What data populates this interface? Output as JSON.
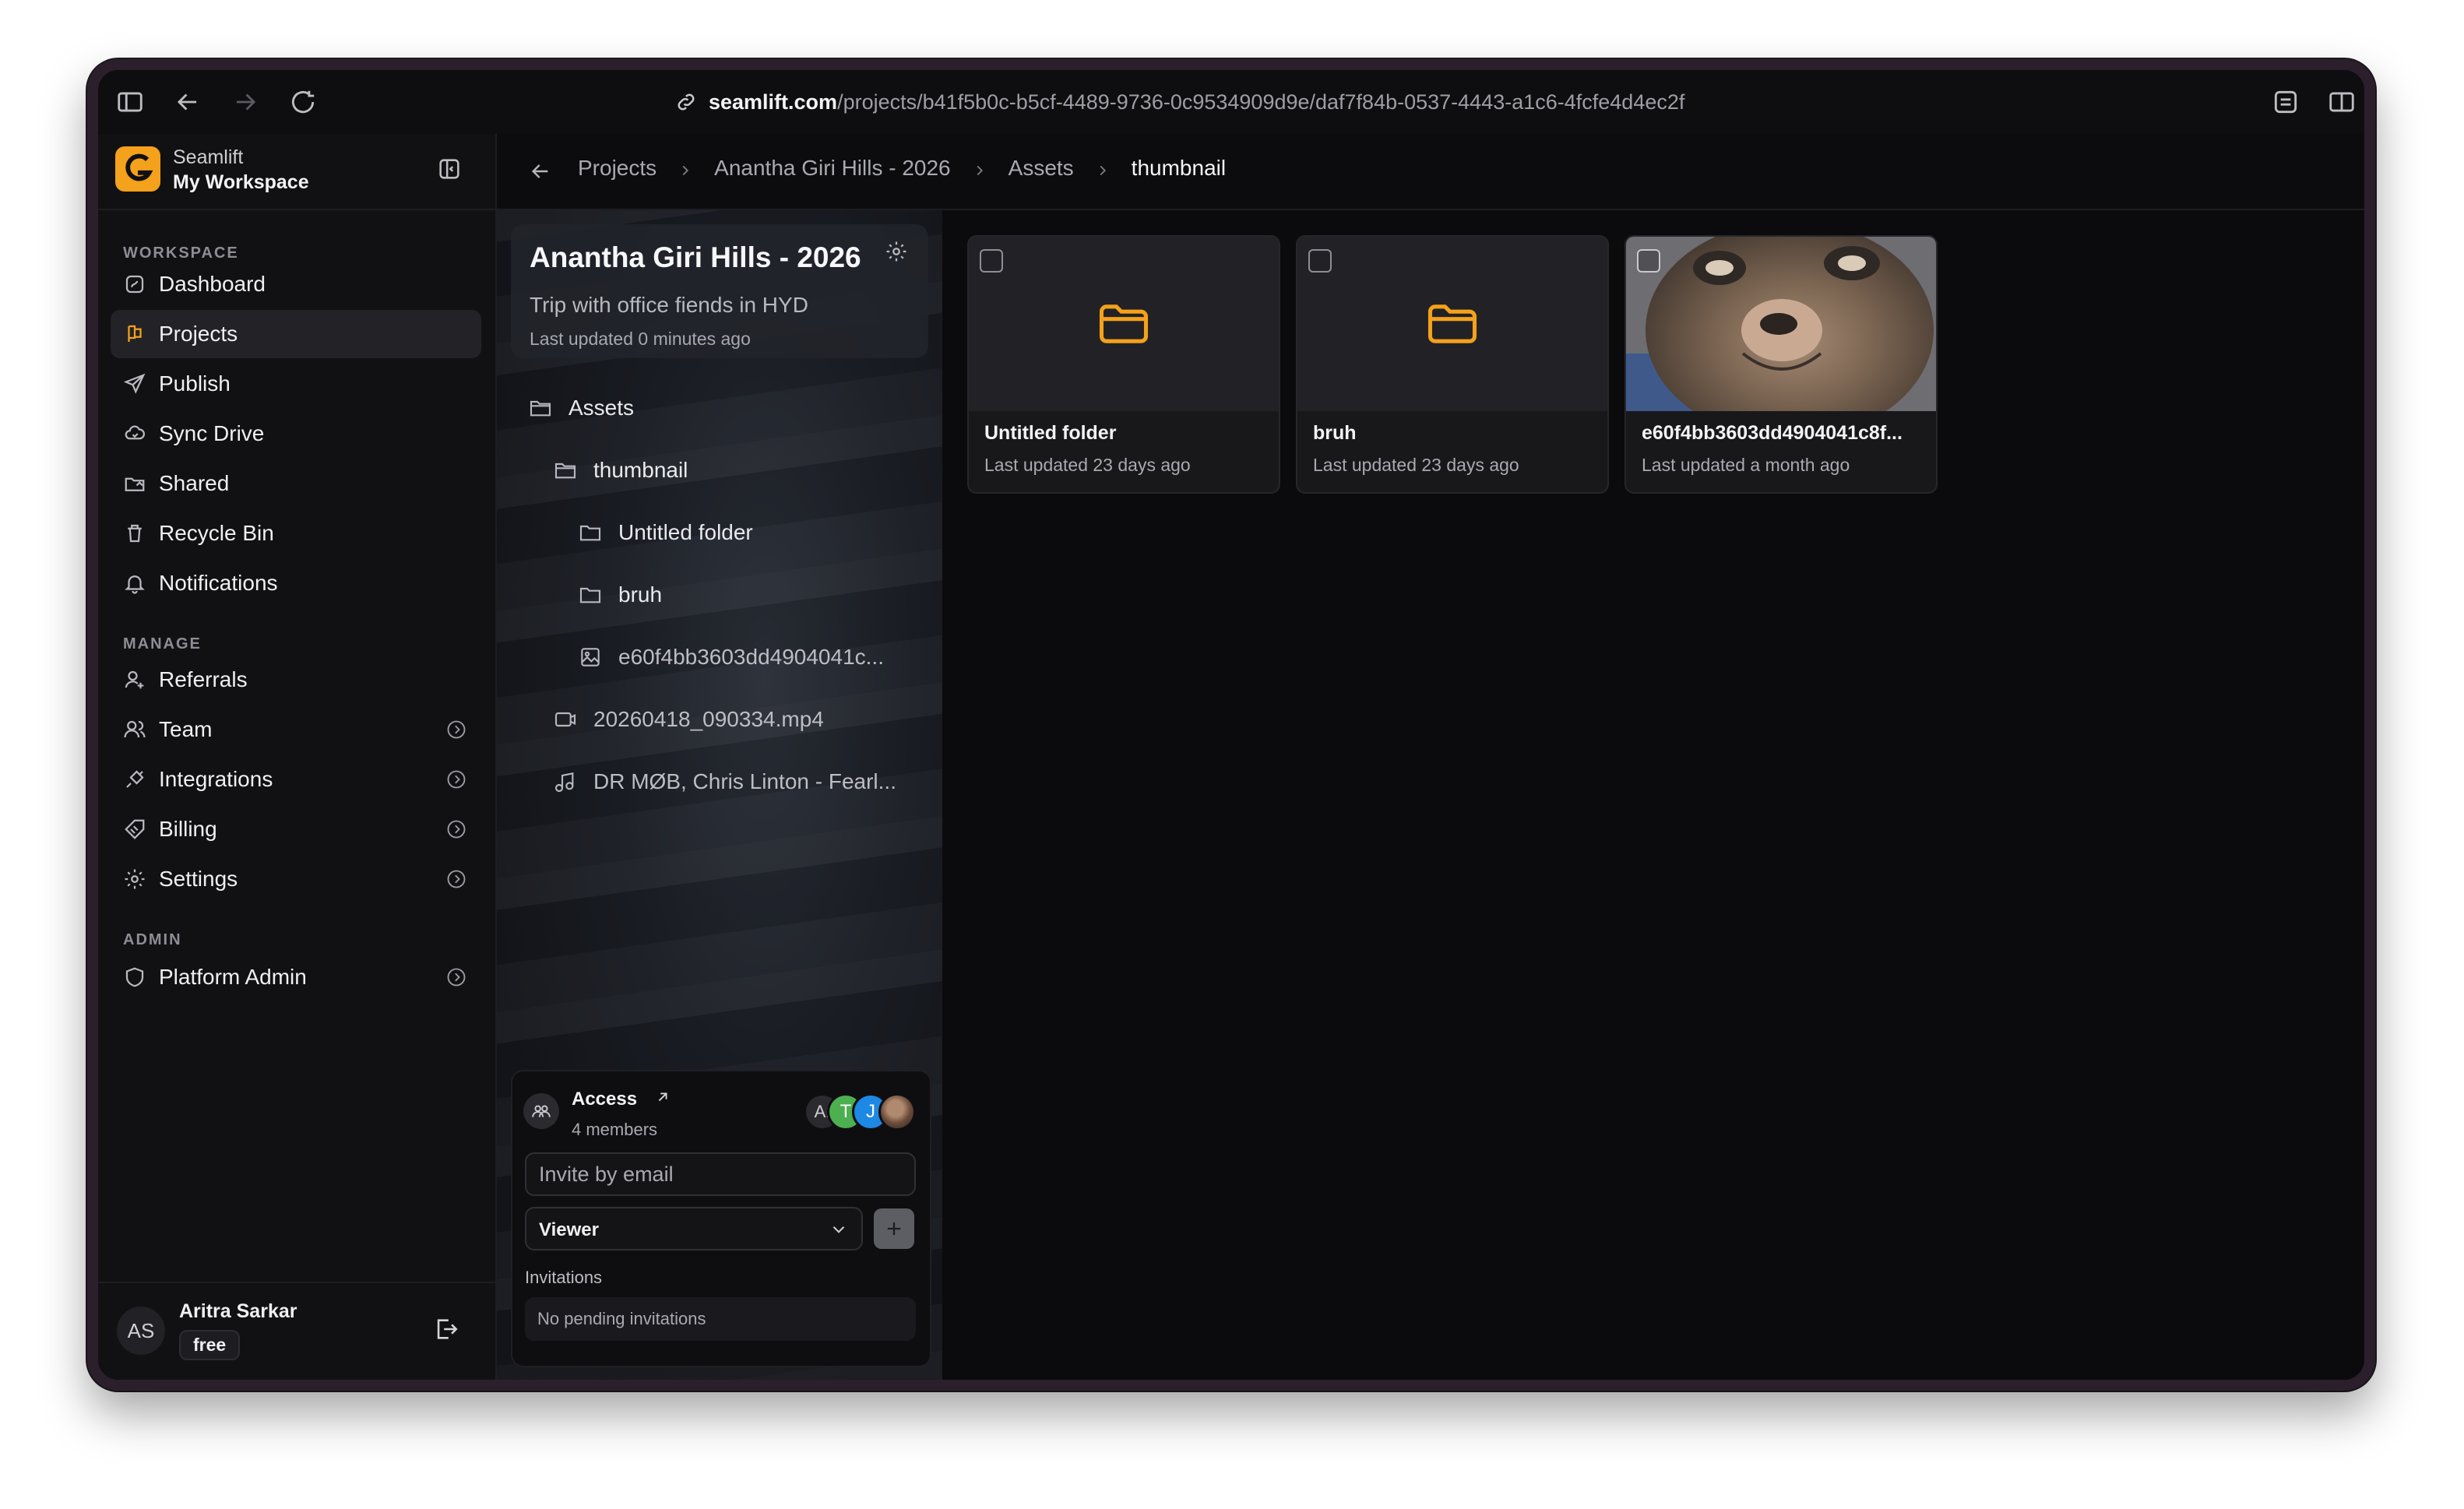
{
  "browser": {
    "url_host": "seamlift.com",
    "url_path": "/projects/b41f5b0c-b5cf-4489-9736-0c9534909d9e/daf7f84b-0537-4443-a1c6-4fcfe4d4ec2f"
  },
  "workspace": {
    "app_name": "Seamlift",
    "name": "My Workspace",
    "accent": "#f4a11b"
  },
  "sidebar": {
    "sections": {
      "workspace": "WORKSPACE",
      "manage": "MANAGE",
      "admin": "ADMIN"
    },
    "workspace_items": [
      {
        "label": "Dashboard",
        "icon": "dashboard-icon"
      },
      {
        "label": "Projects",
        "icon": "projects-icon",
        "active": true
      },
      {
        "label": "Publish",
        "icon": "send-icon"
      },
      {
        "label": "Sync Drive",
        "icon": "cloud-sync-icon"
      },
      {
        "label": "Shared",
        "icon": "shared-folder-icon"
      },
      {
        "label": "Recycle Bin",
        "icon": "trash-icon"
      },
      {
        "label": "Notifications",
        "icon": "bell-icon"
      }
    ],
    "manage_items": [
      {
        "label": "Referrals",
        "icon": "user-plus-icon"
      },
      {
        "label": "Team",
        "icon": "users-icon"
      },
      {
        "label": "Integrations",
        "icon": "plug-icon"
      },
      {
        "label": "Billing",
        "icon": "tag-icon"
      },
      {
        "label": "Settings",
        "icon": "gear-icon"
      }
    ],
    "admin_items": [
      {
        "label": "Platform Admin",
        "icon": "shield-icon"
      }
    ],
    "user": {
      "initials": "AS",
      "name": "Aritra Sarkar",
      "plan": "free"
    }
  },
  "breadcrumb": [
    "Projects",
    "Anantha Giri Hills - 2026",
    "Assets",
    "thumbnail"
  ],
  "project": {
    "title": "Anantha Giri Hills - 2026",
    "description": "Trip with office fiends in HYD",
    "updated": "Last updated 0 minutes ago"
  },
  "tree": [
    {
      "label": "Assets",
      "icon": "folder-icon"
    },
    {
      "label": "thumbnail",
      "icon": "folder-icon"
    },
    {
      "label": "Untitled folder",
      "icon": "folder-icon"
    },
    {
      "label": "bruh",
      "icon": "folder-icon"
    },
    {
      "label": "e60f4bb3603dd4904041c...",
      "icon": "image-icon"
    },
    {
      "label": "20260418_090334.mp4",
      "icon": "video-icon"
    },
    {
      "label": "DR MØB, Chris Linton - Fearl...",
      "icon": "audio-icon"
    }
  ],
  "access": {
    "title": "Access",
    "members": "4 members",
    "avatars": [
      "A:",
      "T",
      "J"
    ],
    "invite_placeholder": "Invite by email",
    "role": "Viewer",
    "invitations_label": "Invitations",
    "invitations_empty": "No pending invitations"
  },
  "assets": [
    {
      "name": "Untitled folder",
      "updated": "Last updated 23 days ago",
      "kind": "folder"
    },
    {
      "name": "bruh",
      "updated": "Last updated 23 days ago",
      "kind": "folder"
    },
    {
      "name": "e60f4bb3603dd4904041c8f...",
      "updated": "Last updated a month ago",
      "kind": "image"
    }
  ]
}
